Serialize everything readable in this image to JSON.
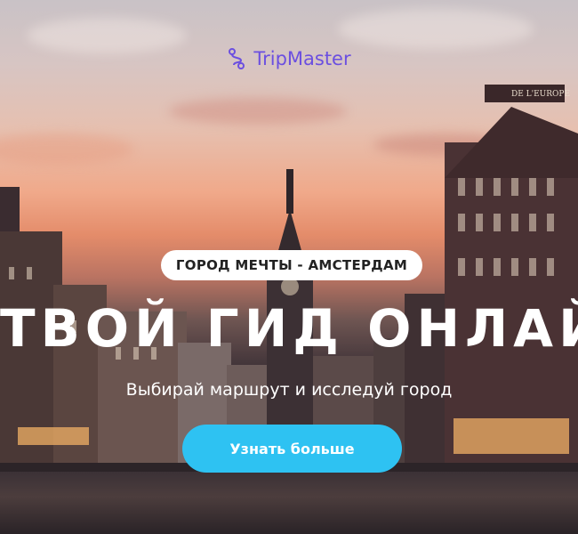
{
  "brand": {
    "name": "TripMaster",
    "color": "#6b4fe0",
    "icon": "route-icon"
  },
  "hero": {
    "badge": "ГОРОД МЕЧТЫ - АМСТЕРДАМ",
    "headline": "ТВОЙ ГИД ОНЛАЙН",
    "subtitle": "Выбирай маршрут и исследуй город",
    "cta_label": "Узнать больше",
    "cta_color": "#2ec2f2",
    "building_sign": "DE L'EUROPE"
  }
}
